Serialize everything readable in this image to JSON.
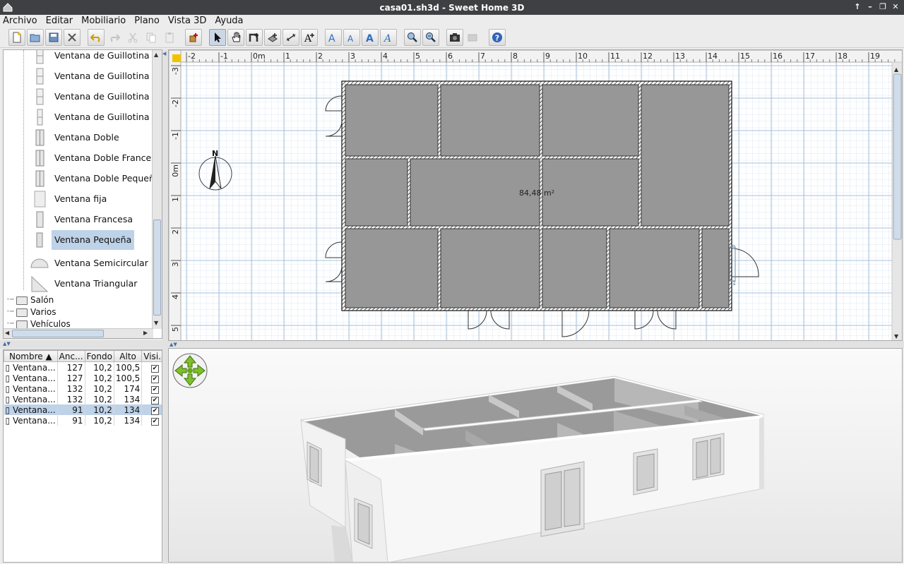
{
  "window": {
    "title": "casa01.sh3d - Sweet Home 3D"
  },
  "menu": [
    {
      "label": "Archivo"
    },
    {
      "label": "Editar"
    },
    {
      "label": "Mobiliario"
    },
    {
      "label": "Plano"
    },
    {
      "label": "Vista 3D"
    },
    {
      "label": "Ayuda"
    }
  ],
  "catalog": {
    "items": [
      {
        "label": "Ventana de Guillotina"
      },
      {
        "label": "Ventana de Guillotina"
      },
      {
        "label": "Ventana de Guillotina"
      },
      {
        "label": "Ventana de Guillotina"
      },
      {
        "label": "Ventana Doble"
      },
      {
        "label": "Ventana Doble Francesa"
      },
      {
        "label": "Ventana Doble Pequeña"
      },
      {
        "label": "Ventana fija"
      },
      {
        "label": "Ventana Francesa"
      },
      {
        "label": "Ventana Pequeña"
      },
      {
        "label": "Ventana Semicircular"
      },
      {
        "label": "Ventana Triangular"
      }
    ],
    "folders": [
      {
        "label": "Salón"
      },
      {
        "label": "Varios"
      },
      {
        "label": "Vehículos"
      }
    ]
  },
  "furniture": {
    "columns": [
      "Nombre ▲",
      "Anc...",
      "Fondo",
      "Alto",
      "Visi..."
    ],
    "rows": [
      {
        "name": "Ventana...",
        "width": "127",
        "depth": "10,2",
        "height": "100,5"
      },
      {
        "name": "Ventana...",
        "width": "127",
        "depth": "10,2",
        "height": "100,5"
      },
      {
        "name": "Ventana...",
        "width": "132",
        "depth": "10,2",
        "height": "174"
      },
      {
        "name": "Ventana...",
        "width": "132",
        "depth": "10,2",
        "height": "134"
      },
      {
        "name": "Ventana...",
        "width": "91",
        "depth": "10,2",
        "height": "134"
      },
      {
        "name": "Ventana...",
        "width": "91",
        "depth": "10,2",
        "height": "134"
      }
    ]
  },
  "plan": {
    "area_label": "84,48 m²",
    "ruler_x": [
      "-2",
      "-1",
      "0m",
      "1",
      "2",
      "3",
      "4",
      "5",
      "6",
      "7",
      "8",
      "9",
      "10",
      "11",
      "12",
      "13",
      "14",
      "15",
      "16",
      "17",
      "18",
      "19"
    ],
    "ruler_y": [
      "-3",
      "-2",
      "-1",
      "0m",
      "1",
      "2",
      "3",
      "4",
      "5"
    ],
    "compass_letter": "N"
  }
}
